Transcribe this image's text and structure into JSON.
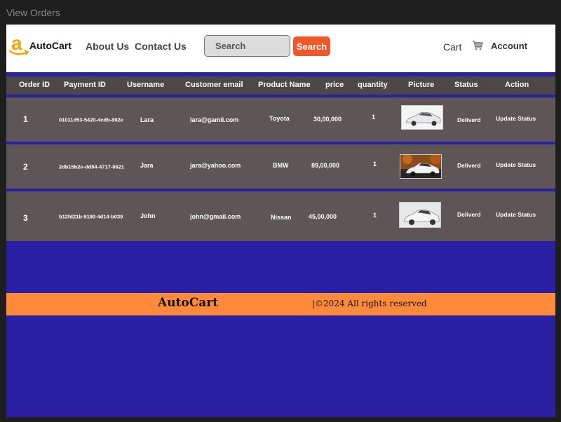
{
  "window": {
    "title": "View Orders"
  },
  "header": {
    "brand": "AutoCart",
    "logo_icon": "amazon-a-smile-icon",
    "nav": [
      "About Us",
      "Contact Us"
    ],
    "search": {
      "placeholder": "Search",
      "button_label": "Search"
    },
    "cart_label": "Cart",
    "cart_icon": "shopping-cart-icon",
    "account_label": "Account"
  },
  "table": {
    "headers": [
      "Order ID",
      "Payment ID",
      "Username",
      "Customer email",
      "Product Name",
      "price",
      "quantity",
      "Picture",
      "Status",
      "Action"
    ],
    "rows": [
      {
        "order_id": "1",
        "payment_id": "01011d53-5420-4cdb-892e",
        "username": "Lara",
        "email": "lara@gamil.com",
        "product": "Toyota",
        "price": "30,00,000",
        "quantity": "1",
        "picture": "white-sedan",
        "status": "Deliverd",
        "action": "Update Status"
      },
      {
        "order_id": "2",
        "payment_id": "2db15b2e-dd84-4717-8621",
        "username": "Jara",
        "email": "jara@yahoo.com",
        "product": "BMW",
        "price": "89,00,000",
        "quantity": "1",
        "picture": "white-suv-autumn",
        "status": "Deliverd",
        "action": "Update Status"
      },
      {
        "order_id": "3",
        "payment_id": "b12fd21b-9190-4d14-b039",
        "username": "John",
        "email": "john@gmail.com",
        "product": "Nissan",
        "price": "45,00,000",
        "quantity": "1",
        "picture": "white-crossover",
        "status": "Deliverd",
        "action": "Update Status"
      }
    ]
  },
  "footer": {
    "brand": "AutoCart",
    "copyright": "|©2024 All rights reserved"
  },
  "colors": {
    "page_bg": "#2a1ea3",
    "accent": "#f0582a",
    "footer_bg": "#ff8a3c",
    "row_bg": "#5e5656"
  }
}
